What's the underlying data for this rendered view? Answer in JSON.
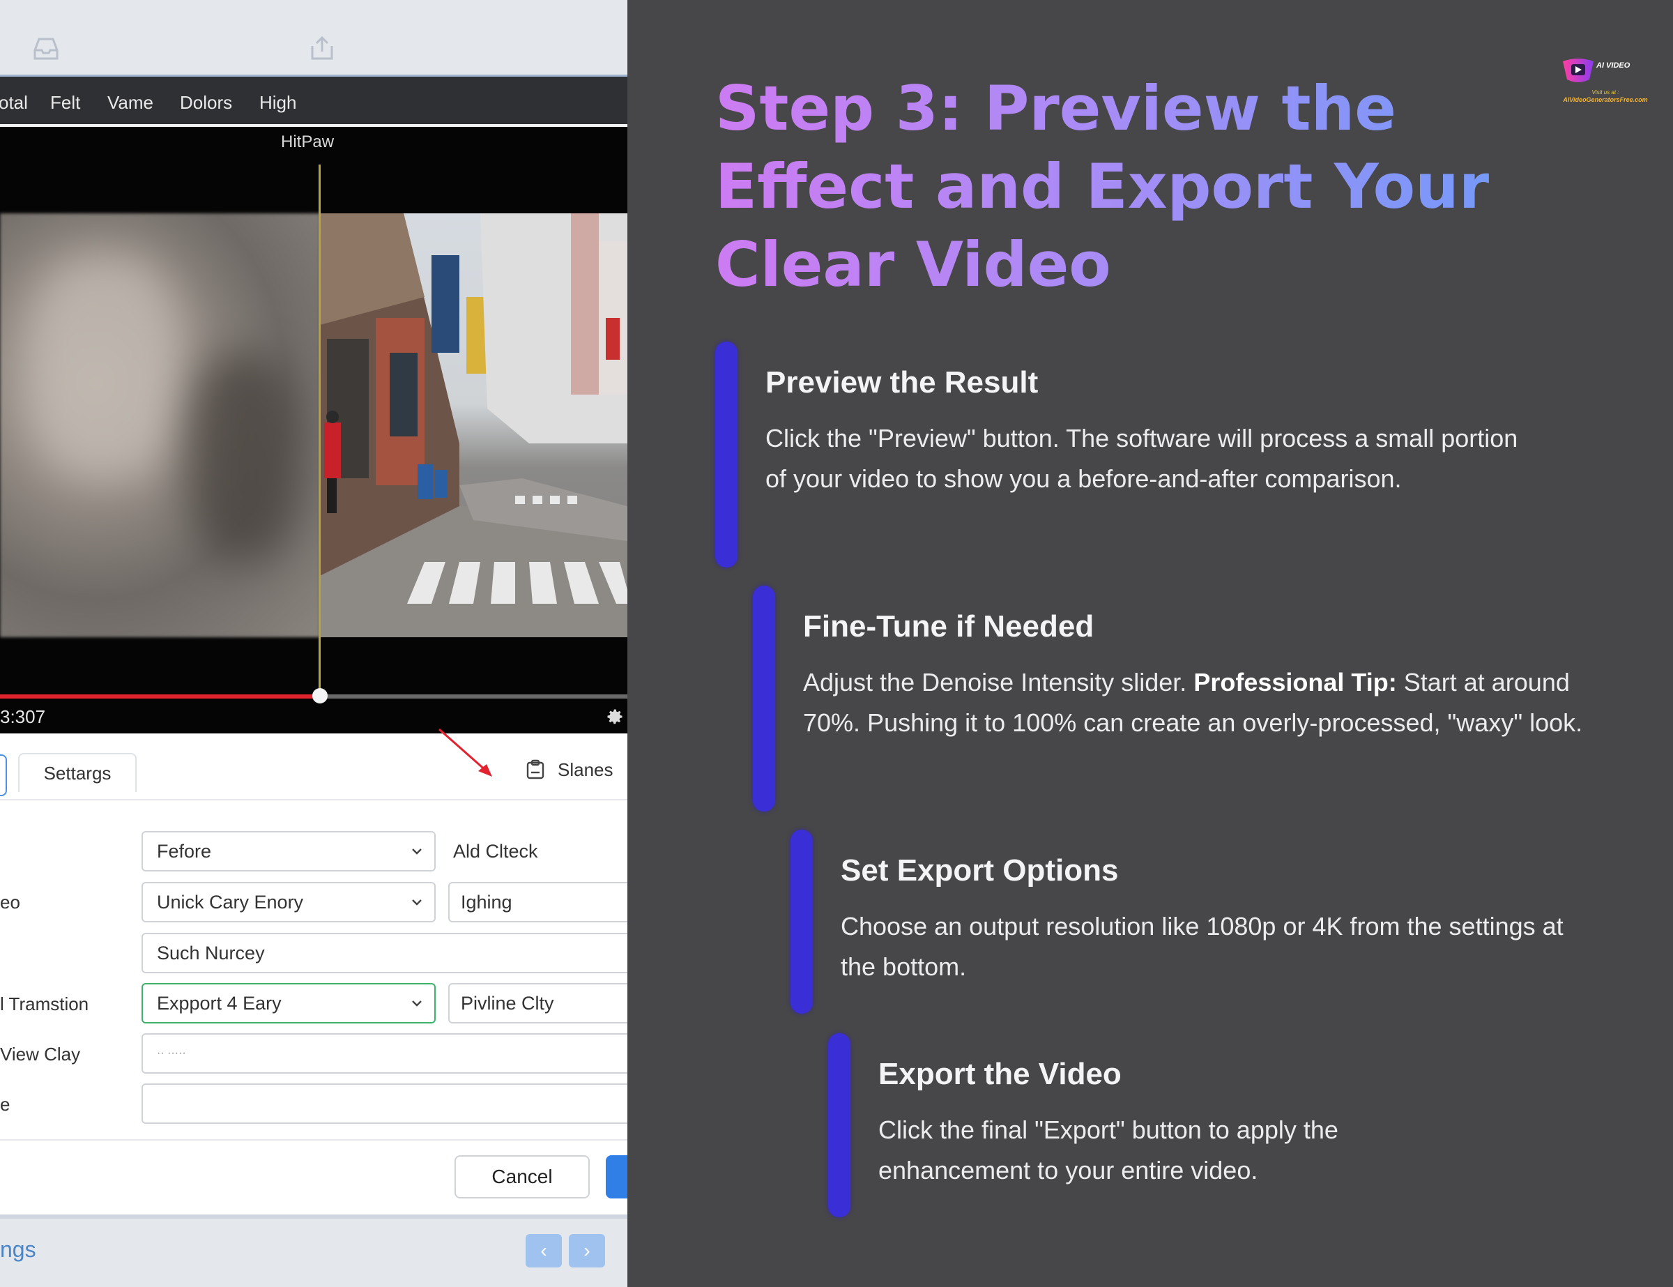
{
  "app": {
    "menu": [
      "otal",
      "Felt",
      "Vame",
      "Dolors",
      "High"
    ],
    "video_label": "HitPaw",
    "timecode": "3:307",
    "progress_fraction": 0.51,
    "tabs": {
      "settings": "Settargs",
      "slanes": "Slanes"
    },
    "form": {
      "rows": [
        {
          "label": "",
          "field": "Fefore",
          "side": "Ald Clteck",
          "side_is_field": false
        },
        {
          "label": "eo",
          "field": "Unick Cary Enory",
          "side": "Ighing",
          "side_is_field": true
        },
        {
          "label": "",
          "field": "Such Nurcey",
          "side": "",
          "side_is_field": false
        },
        {
          "label": "l Tramstion",
          "field": "Expport 4 Eary",
          "side": "Pivline Clty",
          "side_is_field": true
        },
        {
          "label": "View Clay",
          "field": "·· ·····",
          "side": "",
          "side_is_field": false
        },
        {
          "label": "e",
          "field": "",
          "side": "",
          "side_is_field": false
        }
      ]
    },
    "cancel_label": "Cancel",
    "footer_text": "ngs",
    "nav": {
      "prev": "‹",
      "next": "›"
    }
  },
  "headline": "Step 3: Preview the Effect and Export Your Clear Video",
  "logo": {
    "main": "AI VIDEO",
    "visit": "Visit us at :",
    "url": "AIVideoGeneratorsFree.com"
  },
  "steps": [
    {
      "title": "Preview the Result",
      "desc": "Click the \"Preview\" button. The software will process a small portion of your video to show you a before-and-after comparison."
    },
    {
      "title": "Fine-Tune if Needed",
      "desc_before": "Adjust the Denoise Intensity slider. ",
      "desc_bold": "Professional Tip:",
      "desc_after": " Start at around 70%. Pushing it to 100% can create an overly-processed, \"waxy\" look."
    },
    {
      "title": "Set Export Options",
      "desc": "Choose an output resolution like 1080p or 4K from the settings at the bottom."
    },
    {
      "title": "Export the Video",
      "desc": "Click the final \"Export\" button to apply the enhancement to your entire video."
    }
  ],
  "colors": {
    "accent_bar": "#3a2fd6",
    "headline_gradient": [
      "#cd7cf2",
      "#6f9bf8"
    ],
    "progress": "#e0222a",
    "background": "#474648"
  }
}
